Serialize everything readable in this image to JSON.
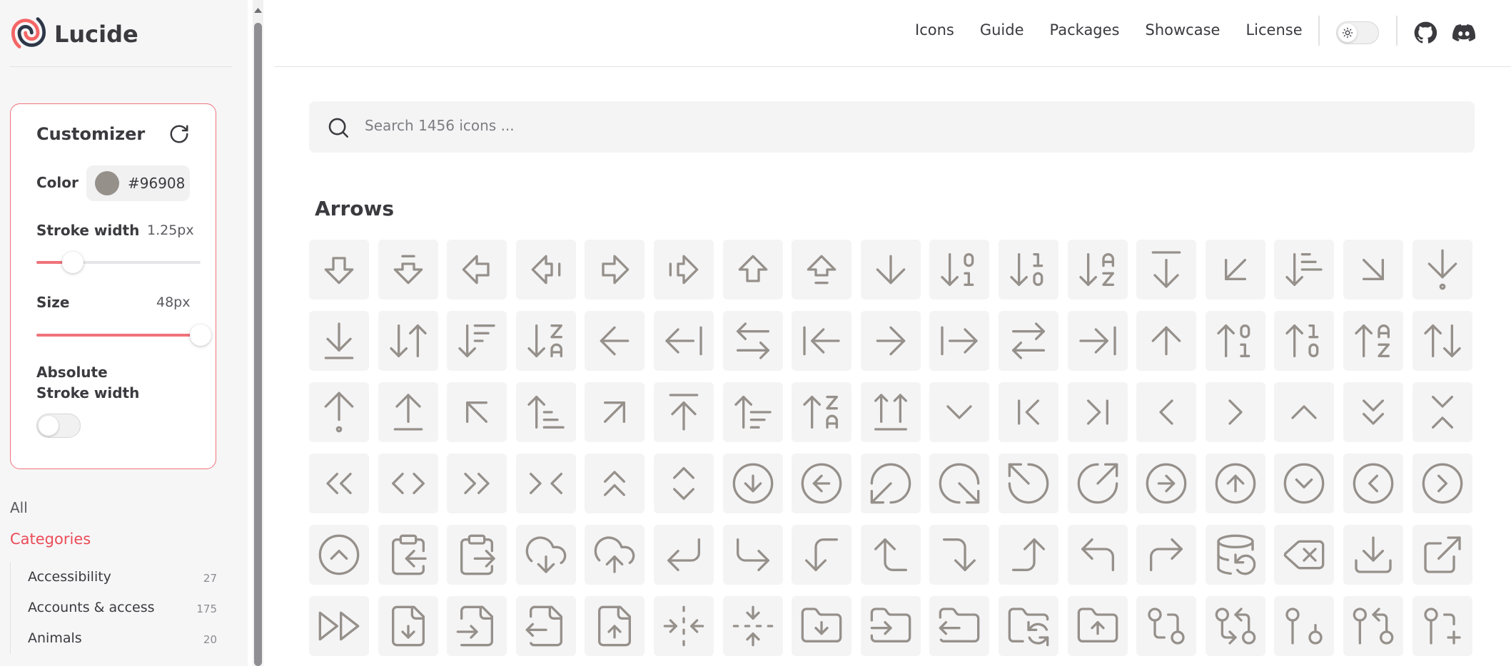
{
  "brand": {
    "name": "Lucide"
  },
  "customizer": {
    "title": "Customizer",
    "color_label": "Color",
    "color_value": "#96908",
    "swatch_color": "#96908b",
    "stroke_label": "Stroke width",
    "stroke_value": "1.25px",
    "stroke_fraction": 0.22,
    "size_label": "Size",
    "size_value": "48px",
    "size_fraction": 1.0,
    "abs_label": "Absolute Stroke width",
    "abs_enabled": false
  },
  "nav": {
    "all_label": "All",
    "categories_label": "Categories",
    "categories": [
      {
        "name": "Accessibility",
        "count": "27"
      },
      {
        "name": "Accounts & access",
        "count": "175"
      },
      {
        "name": "Animals",
        "count": "20"
      }
    ]
  },
  "header": {
    "links": [
      "Icons",
      "Guide",
      "Packages",
      "Showcase",
      "License"
    ]
  },
  "search": {
    "placeholder": "Search 1456 icons ..."
  },
  "section": {
    "title": "Arrows"
  },
  "icons": [
    "arrow-big-down",
    "arrow-big-down-dash",
    "arrow-big-left",
    "arrow-big-left-dash",
    "arrow-big-right",
    "arrow-big-right-dash",
    "arrow-big-up",
    "arrow-big-up-dash",
    "arrow-down",
    "arrow-down-0-1",
    "arrow-down-1-0",
    "arrow-down-a-z",
    "arrow-down-from-line",
    "arrow-down-left",
    "arrow-down-narrow-wide",
    "arrow-down-right",
    "arrow-down-to-dot",
    "arrow-down-to-line",
    "arrow-down-up",
    "arrow-down-wide-narrow",
    "arrow-down-z-a",
    "arrow-left",
    "arrow-left-from-line",
    "arrow-left-right",
    "arrow-left-to-line",
    "arrow-right",
    "arrow-right-from-line",
    "arrow-right-left",
    "arrow-right-to-line",
    "arrow-up",
    "arrow-up-0-1",
    "arrow-up-1-0",
    "arrow-up-a-z",
    "arrow-up-down",
    "arrow-up-from-dot",
    "arrow-up-from-line",
    "arrow-up-left",
    "arrow-up-narrow-wide",
    "arrow-up-right",
    "arrow-up-to-line",
    "arrow-up-wide-narrow",
    "arrow-up-z-a",
    "arrows-up-from-line",
    "chevron-down",
    "chevron-first",
    "chevron-last",
    "chevron-left",
    "chevron-right",
    "chevron-up",
    "chevrons-down",
    "chevrons-down-up",
    "chevrons-left",
    "chevrons-left-right",
    "chevrons-right",
    "chevrons-right-left",
    "chevrons-up",
    "chevrons-up-down",
    "circle-arrow-down",
    "circle-arrow-left",
    "circle-arrow-out-down-left",
    "circle-arrow-out-down-right",
    "circle-arrow-out-up-left",
    "circle-arrow-out-up-right",
    "circle-arrow-right",
    "circle-arrow-up",
    "circle-chevron-down",
    "circle-chevron-left",
    "circle-chevron-right",
    "circle-chevron-up",
    "clipboard-arrow-left",
    "clipboard-arrow-right",
    "cloud-download",
    "cloud-upload",
    "corner-down-left",
    "corner-down-right",
    "corner-left-down",
    "corner-left-up",
    "corner-right-down",
    "corner-right-up",
    "corner-up-left",
    "corner-up-right",
    "database-backup",
    "delete",
    "download",
    "external-link",
    "fast-forward",
    "file-down",
    "file-input",
    "file-output",
    "file-up",
    "fold-horizontal",
    "fold-vertical",
    "folder-down",
    "folder-input",
    "folder-output",
    "folder-sync",
    "folder-up",
    "git-compare",
    "git-compare-arrows",
    "git-pull-request-closed",
    "git-pull-request-arrow",
    "git-pull-request-create"
  ],
  "icon_color": "#96908b",
  "accent_color": "#f0737a"
}
